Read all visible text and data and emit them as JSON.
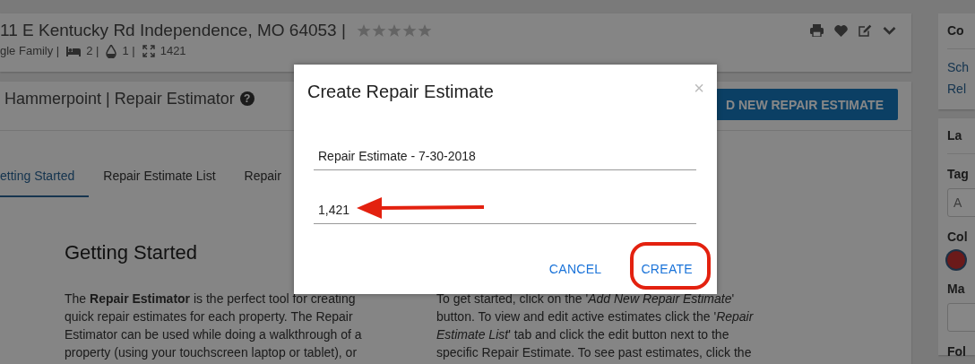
{
  "property": {
    "address": "11 E Kentucky Rd Independence, MO 64053 |",
    "stars": 0,
    "details": [
      {
        "kind": "type",
        "text": "gle Family |"
      },
      {
        "kind": "beds",
        "text": "2 |"
      },
      {
        "kind": "baths",
        "text": "1 |"
      },
      {
        "kind": "area",
        "text": "1421"
      }
    ],
    "actions": [
      {
        "kind": "print"
      },
      {
        "kind": "favorite"
      },
      {
        "kind": "edit"
      },
      {
        "kind": "expand"
      }
    ]
  },
  "tool": {
    "title": "Hammerpoint | Repair Estimator",
    "help": "?",
    "add_button": "D NEW REPAIR ESTIMATE",
    "tabs": [
      {
        "label": "etting Started",
        "selected": true
      },
      {
        "label": "Repair Estimate List",
        "selected": false
      },
      {
        "label": "Repair",
        "selected": false
      }
    ],
    "heading": "Getting Started",
    "paragraphs": [
      [
        "The **Repair Estimator** is the perfect tool for creating",
        "quick repair estimates for each property. The Repair",
        "Estimator can be used while doing a walkthrough of a",
        "property (using your touchscreen laptop or tablet), or"
      ],
      [
        "To get started, click on the '*Add New Repair Estimate*'",
        "button. To view and edit active estimates click the '*Repair*",
        "*Estimate List*' tab and click the edit button next to the",
        "specific Repair Estimate. To see past estimates, click the"
      ]
    ]
  },
  "sidebar": {
    "contact": {
      "header": "Co",
      "links": [
        "Sch",
        "Rel"
      ]
    },
    "labels": {
      "header": "La",
      "tags_label": "Tag",
      "tags_placeholder": "A",
      "color_label": "Col",
      "color": "#6b1a1a",
      "manager_label": "Ma",
      "follow_label": "Fol"
    }
  },
  "dialog": {
    "title": "Create Repair Estimate",
    "close": "×",
    "fields": [
      {
        "value": "Repair Estimate - 7-30-2018"
      },
      {
        "value": "1,421"
      }
    ],
    "buttons": [
      "CANCEL",
      "CREATE"
    ]
  }
}
